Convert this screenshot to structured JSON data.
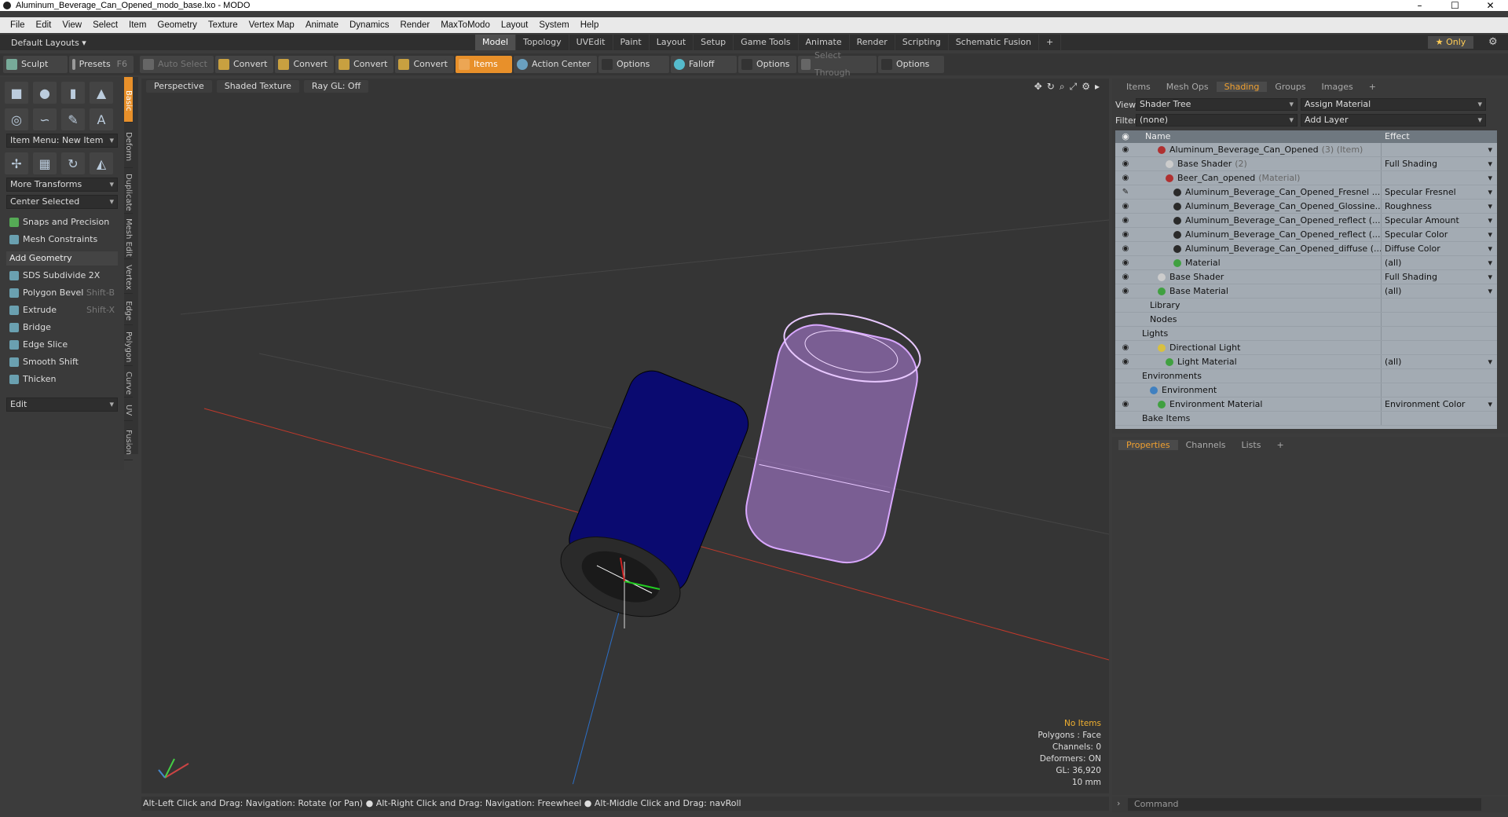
{
  "window": {
    "title": "Aluminum_Beverage_Can_Opened_modo_base.lxo - MODO",
    "min": "–",
    "max": "☐",
    "close": "✕"
  },
  "menu": [
    "File",
    "Edit",
    "View",
    "Select",
    "Item",
    "Geometry",
    "Texture",
    "Vertex Map",
    "Animate",
    "Dynamics",
    "Render",
    "MaxToModo",
    "Layout",
    "System",
    "Help"
  ],
  "layoutbar": {
    "default_layouts": "Default Layouts ▾",
    "tabs": [
      "Model",
      "Topology",
      "UVEdit",
      "Paint",
      "Layout",
      "Setup",
      "Game Tools",
      "Animate",
      "Render",
      "Scripting",
      "Schematic Fusion",
      "+"
    ],
    "active_tab": "Model",
    "only": "★ Only"
  },
  "toolbar": {
    "sculpt": "Sculpt",
    "presets": "Presets",
    "presets_key": "F6",
    "auto_select": "Auto Select",
    "convert": "Convert",
    "items": "Items",
    "action_center": "Action Center",
    "options": "Options",
    "falloff": "Falloff",
    "select_through": "Select Through"
  },
  "left": {
    "item_menu": "Item Menu: New Item",
    "more_transforms": "More Transforms",
    "center_selected": "Center Selected",
    "snaps": "Snaps and Precision",
    "mesh_constraints": "Mesh Constraints",
    "add_geometry": "Add Geometry",
    "tools": [
      {
        "label": "SDS Subdivide 2X",
        "key": ""
      },
      {
        "label": "Polygon Bevel",
        "key": "Shift-B"
      },
      {
        "label": "Extrude",
        "key": "Shift-X"
      },
      {
        "label": "Bridge",
        "key": ""
      },
      {
        "label": "Edge Slice",
        "key": ""
      },
      {
        "label": "Smooth Shift",
        "key": ""
      },
      {
        "label": "Thicken",
        "key": ""
      }
    ],
    "edit": "Edit",
    "sidetabs": [
      "Basic",
      "Deform",
      "Duplicate",
      "Mesh Edit",
      "Vertex",
      "Edge",
      "Polygon",
      "Curve",
      "UV",
      "Fusion"
    ]
  },
  "viewport": {
    "perspective": "Perspective",
    "shaded": "Shaded Texture",
    "raygl": "Ray GL: Off",
    "info": {
      "no_items": "No Items",
      "polygons": "Polygons : Face",
      "channels": "Channels: 0",
      "deformers": "Deformers: ON",
      "gl": "GL: 36,920",
      "unit": "10 mm"
    }
  },
  "status": "Alt-Left Click and Drag: Navigation: Rotate (or Pan) ● Alt-Right Click and Drag: Navigation: Freewheel ● Alt-Middle Click and Drag: navRoll",
  "right": {
    "tabs": [
      "Items",
      "Mesh Ops",
      "Shading",
      "Groups",
      "Images",
      "+"
    ],
    "active_tab": "Shading",
    "view_label": "View",
    "view_value": "Shader Tree",
    "assign": "Assign Material",
    "filter_label": "Filter",
    "filter_value": "(none)",
    "add_layer": "Add Layer",
    "col_name": "Name",
    "col_effect": "Effect",
    "rows": [
      {
        "eye": "◉",
        "indent": 2,
        "name": "Aluminum_Beverage_Can_Opened",
        "note": "(3) (Item)",
        "icon": "#b03030",
        "effect": "",
        "dd": true
      },
      {
        "eye": "◉",
        "indent": 3,
        "name": "Base Shader",
        "note": "(2)",
        "icon": "#ccc",
        "effect": "Full Shading",
        "dd": true
      },
      {
        "eye": "◉",
        "indent": 3,
        "name": "Beer_Can_opened",
        "note": "(Material)",
        "icon": "#b03030",
        "effect": "",
        "dd": true
      },
      {
        "eye": "✎",
        "indent": 4,
        "name": "Aluminum_Beverage_Can_Opened_Fresnel ...",
        "note": "",
        "icon": "#2a2a2a",
        "effect": "Specular Fresnel",
        "dd": true
      },
      {
        "eye": "◉",
        "indent": 4,
        "name": "Aluminum_Beverage_Can_Opened_Glossine...",
        "note": "",
        "icon": "#2a2a2a",
        "effect": "Roughness",
        "dd": true
      },
      {
        "eye": "◉",
        "indent": 4,
        "name": "Aluminum_Beverage_Can_Opened_reflect (...",
        "note": "",
        "icon": "#2a2a2a",
        "effect": "Specular Amount",
        "dd": true
      },
      {
        "eye": "◉",
        "indent": 4,
        "name": "Aluminum_Beverage_Can_Opened_reflect (...",
        "note": "",
        "icon": "#2a2a2a",
        "effect": "Specular Color",
        "dd": true
      },
      {
        "eye": "◉",
        "indent": 4,
        "name": "Aluminum_Beverage_Can_Opened_diffuse (...",
        "note": "",
        "icon": "#2a2a2a",
        "effect": "Diffuse Color",
        "dd": true
      },
      {
        "eye": "◉",
        "indent": 4,
        "name": "Material",
        "note": "",
        "icon": "#40a040",
        "effect": "(all)",
        "dd": true
      },
      {
        "eye": "◉",
        "indent": 2,
        "name": "Base Shader",
        "note": "",
        "icon": "#ccc",
        "effect": "Full Shading",
        "dd": true
      },
      {
        "eye": "◉",
        "indent": 2,
        "name": "Base Material",
        "note": "",
        "icon": "#40a040",
        "effect": "(all)",
        "dd": true
      },
      {
        "eye": "",
        "indent": 1,
        "name": "Library",
        "note": "",
        "icon": "",
        "effect": "",
        "dd": false
      },
      {
        "eye": "",
        "indent": 1,
        "name": "Nodes",
        "note": "",
        "icon": "",
        "effect": "",
        "dd": false
      },
      {
        "eye": "",
        "indent": 0,
        "name": "Lights",
        "note": "",
        "icon": "",
        "effect": "",
        "dd": false
      },
      {
        "eye": "◉",
        "indent": 2,
        "name": "Directional Light",
        "note": "",
        "icon": "#d8c040",
        "effect": "",
        "dd": false
      },
      {
        "eye": "◉",
        "indent": 3,
        "name": "Light Material",
        "note": "",
        "icon": "#40a040",
        "effect": "(all)",
        "dd": true
      },
      {
        "eye": "",
        "indent": 0,
        "name": "Environments",
        "note": "",
        "icon": "",
        "effect": "",
        "dd": false
      },
      {
        "eye": "",
        "indent": 1,
        "name": "Environment",
        "note": "",
        "icon": "#4080c0",
        "effect": "",
        "dd": false
      },
      {
        "eye": "◉",
        "indent": 2,
        "name": "Environment Material",
        "note": "",
        "icon": "#40a040",
        "effect": "Environment Color",
        "dd": true
      },
      {
        "eye": "",
        "indent": 0,
        "name": "Bake Items",
        "note": "",
        "icon": "",
        "effect": "",
        "dd": false
      }
    ],
    "props_tabs": [
      "Properties",
      "Channels",
      "Lists",
      "+"
    ],
    "command_placeholder": "Command"
  }
}
